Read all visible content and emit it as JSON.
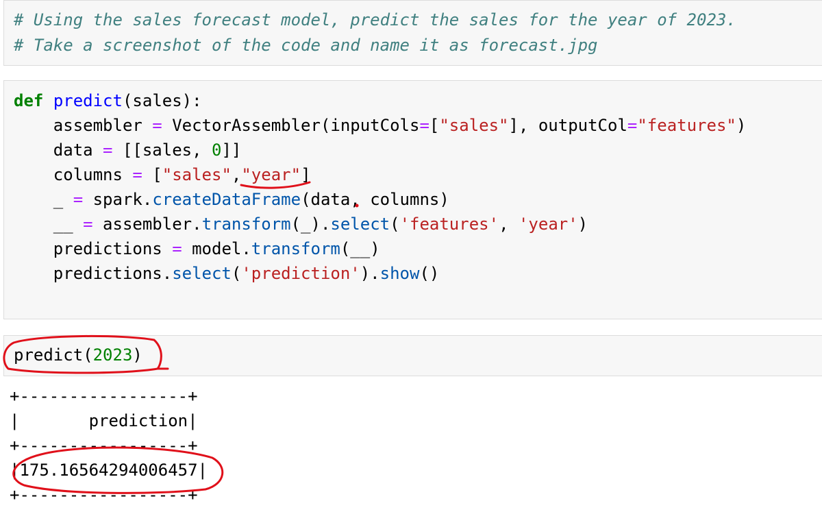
{
  "comment_cell": {
    "line1": "# Using the sales forecast model, predict the sales for the year of 2023.",
    "line2": "# Take a screenshot of the code and name it as forecast.jpg"
  },
  "code_cell": {
    "def_kw": "def",
    "func_name": "predict",
    "def_rest": "(sales):",
    "l2_a": "    assembler ",
    "l2_eq": "=",
    "l2_b": " VectorAssembler(inputCols",
    "l2_eq2": "=",
    "l2_c": "[",
    "l2_str1": "\"sales\"",
    "l2_d": "], outputCol",
    "l2_eq3": "=",
    "l2_str2": "\"features\"",
    "l2_e": ")",
    "l3_a": "    data ",
    "l3_eq": "=",
    "l3_b": " [[sales, ",
    "l3_num": "0",
    "l3_c": "]]",
    "l4_a": "    columns ",
    "l4_eq": "=",
    "l4_b": " [",
    "l4_str1": "\"sales\"",
    "l4_c": ",",
    "l4_str2": "\"year\"",
    "l4_d": "]",
    "l5_a": "    _ ",
    "l5_eq": "=",
    "l5_b": " spark.",
    "l5_meth": "createDataFrame",
    "l5_c": "(data, columns)",
    "l6_a": "    __ ",
    "l6_eq": "=",
    "l6_b": " assembler.",
    "l6_meth1": "transform",
    "l6_c": "(_).",
    "l6_meth2": "select",
    "l6_d": "(",
    "l6_str1": "'features'",
    "l6_e": ", ",
    "l6_str2": "'year'",
    "l6_f": ")",
    "l7_a": "    predictions ",
    "l7_eq": "=",
    "l7_b": " model.",
    "l7_meth": "transform",
    "l7_c": "(__)",
    "l8_a": "    predictions.",
    "l8_meth1": "select",
    "l8_b": "(",
    "l8_str": "'prediction'",
    "l8_c": ").",
    "l8_meth2": "show",
    "l8_d": "()"
  },
  "call_cell": {
    "func": "predict(",
    "arg": "2023",
    "close": ")"
  },
  "output": {
    "border_top": "+-----------------+",
    "header": "|       prediction|",
    "border_mid": "+-----------------+",
    "value_row": "|175.1656429400645 7|",
    "value_row_text": "|175.16564294006457|",
    "border_bottom": "+-----------------+"
  },
  "colors": {
    "annotation": "#e0101a",
    "cell_bg": "#f7f7f7"
  }
}
